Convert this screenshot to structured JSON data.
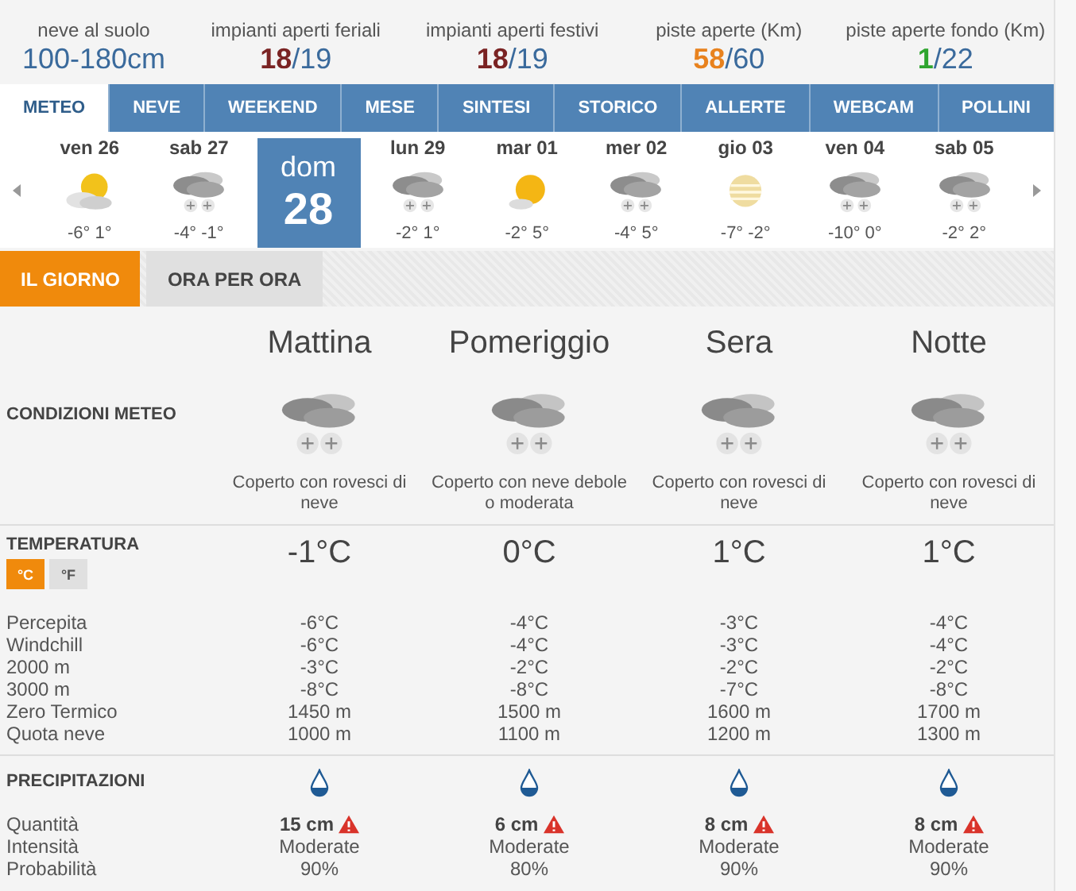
{
  "stats": [
    {
      "label": "neve al suolo",
      "value": "100-180cm",
      "color": "#3a6a9c"
    },
    {
      "label": "impianti aperti feriali",
      "value": "18",
      "total": "/19",
      "color": "#7a2323"
    },
    {
      "label": "impianti aperti festivi",
      "value": "18",
      "total": "/19",
      "color": "#7a2323"
    },
    {
      "label": "piste aperte (Km)",
      "value": "58",
      "total": "/60",
      "color": "#e8821e"
    },
    {
      "label": "piste aperte fondo (Km)",
      "value": "1",
      "total": "/22",
      "color": "#2fa52f"
    }
  ],
  "tabs": [
    {
      "label": "METEO",
      "selected": true
    },
    {
      "label": "NEVE",
      "selected": false
    },
    {
      "label": "WEEKEND",
      "selected": false
    },
    {
      "label": "MESE",
      "selected": false
    },
    {
      "label": "SINTESI",
      "selected": false
    },
    {
      "label": "STORICO",
      "selected": false
    },
    {
      "label": "ALLERTE",
      "selected": false
    },
    {
      "label": "WEBCAM",
      "selected": false
    },
    {
      "label": "POLLINI",
      "selected": false
    }
  ],
  "days": [
    {
      "weekday": "ven",
      "date": "26",
      "kind": "sun-cloud",
      "min": "-6°",
      "max": "1°",
      "selected": false
    },
    {
      "weekday": "sab",
      "date": "27",
      "kind": "snow",
      "min": "-4°",
      "max": "-1°",
      "selected": false
    },
    {
      "weekday": "dom",
      "date": "28",
      "selected": true
    },
    {
      "weekday": "lun",
      "date": "29",
      "kind": "snow",
      "min": "-2°",
      "max": "1°",
      "selected": false
    },
    {
      "weekday": "mar",
      "date": "01",
      "kind": "sun",
      "min": "-2°",
      "max": "5°",
      "selected": false
    },
    {
      "weekday": "mer",
      "date": "02",
      "kind": "snow",
      "min": "-4°",
      "max": "5°",
      "selected": false
    },
    {
      "weekday": "gio",
      "date": "03",
      "kind": "haze",
      "min": "-7°",
      "max": "-2°",
      "selected": false
    },
    {
      "weekday": "ven",
      "date": "04",
      "kind": "snow",
      "min": "-10°",
      "max": "0°",
      "selected": false
    },
    {
      "weekday": "sab",
      "date": "05",
      "kind": "snow",
      "min": "-2°",
      "max": "2°",
      "selected": false
    }
  ],
  "subtabs": [
    {
      "label": "IL GIORNO",
      "selected": true
    },
    {
      "label": "ORA PER ORA",
      "selected": false
    }
  ],
  "periods": [
    "Mattina",
    "Pomeriggio",
    "Sera",
    "Notte"
  ],
  "conditions": {
    "label": "CONDIZIONI METEO",
    "items": [
      {
        "kind": "snow",
        "text": "Coperto con rovesci di neve"
      },
      {
        "kind": "snow",
        "text": "Coperto con neve debole o moderata"
      },
      {
        "kind": "snow",
        "text": "Coperto con rovesci di neve"
      },
      {
        "kind": "snow",
        "text": "Coperto con rovesci di neve"
      }
    ]
  },
  "temperature": {
    "label": "TEMPERATURA",
    "units": [
      {
        "label": "°C",
        "selected": true
      },
      {
        "label": "°F",
        "selected": false
      }
    ],
    "main": [
      "-1°C",
      "0°C",
      "1°C",
      "1°C"
    ],
    "rows": [
      {
        "label": "Percepita",
        "values": [
          "-6°C",
          "-4°C",
          "-3°C",
          "-4°C"
        ]
      },
      {
        "label": "Windchill",
        "values": [
          "-6°C",
          "-4°C",
          "-3°C",
          "-4°C"
        ]
      },
      {
        "label": "2000 m",
        "values": [
          "-3°C",
          "-2°C",
          "-2°C",
          "-2°C"
        ]
      },
      {
        "label": "3000 m",
        "values": [
          "-8°C",
          "-8°C",
          "-7°C",
          "-8°C"
        ]
      },
      {
        "label": "Zero Termico",
        "values": [
          "1450 m",
          "1500 m",
          "1600 m",
          "1700 m"
        ]
      },
      {
        "label": "Quota neve",
        "values": [
          "1000 m",
          "1100 m",
          "1200 m",
          "1300 m"
        ]
      }
    ]
  },
  "precipitation": {
    "label": "PRECIPITAZIONI",
    "rows": [
      {
        "label": "Quantità",
        "kind": "amount",
        "values": [
          "15 cm",
          "6 cm",
          "8 cm",
          "8 cm"
        ]
      },
      {
        "label": "Intensità",
        "kind": "plain",
        "values": [
          "Moderate",
          "Moderate",
          "Moderate",
          "Moderate"
        ]
      },
      {
        "label": "Probabilità",
        "kind": "plain",
        "values": [
          "90%",
          "80%",
          "90%",
          "90%"
        ]
      }
    ]
  }
}
